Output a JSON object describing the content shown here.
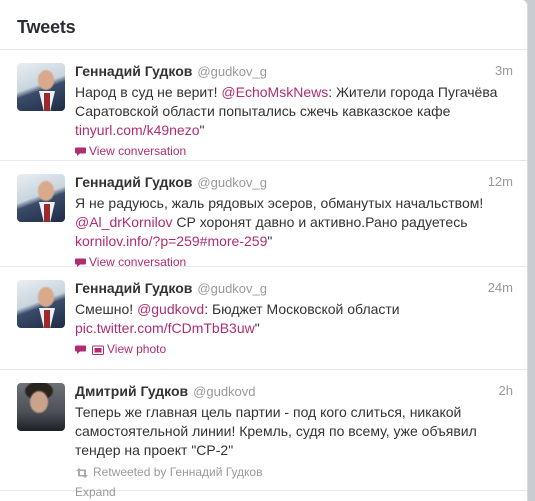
{
  "header": {
    "title": "Tweets"
  },
  "tweets": [
    {
      "name": "Геннадий Гудков",
      "handle": "@gudkov_g",
      "time": "3m",
      "text_before": "Народ в суд не верит! ",
      "mention": "@EchoMskNews",
      "text_after": ": Жители города Пугачёва Саратовской области попытались сжечь кавказское кафе ",
      "url": "tinyurl.com/k49nezo",
      "tail": "\"",
      "action": "View conversation"
    },
    {
      "name": "Геннадий Гудков",
      "handle": "@gudkov_g",
      "time": "12m",
      "text_before": "Я не радуюсь, жаль рядовых эсеров, обманутых начальством! ",
      "mention": "@Al_drKornilov",
      "text_after": " СР хоронят давно и активно.Рано радуетесь ",
      "url": "kornilov.info/?p=259#more-259",
      "tail": "\"",
      "action": "View conversation"
    },
    {
      "name": "Геннадий Гудков",
      "handle": "@gudkov_g",
      "time": "24m",
      "text_before": "Смешно! ",
      "mention": "@gudkovd",
      "text_after": ": Бюджет Московской области ",
      "url": "pic.twitter.com/fCDmTbB3uw",
      "tail": "\"",
      "action": "View photo"
    },
    {
      "name": "Дмитрий Гудков",
      "handle": "@gudkovd",
      "time": "2h",
      "text": "Теперь же главная цель партии - под кого слиться, никакой самостоятельной линии! Кремль, судя по всему, уже объявил тендер на проект \"СР-2\"",
      "retweeted_by": "Retweeted by Геннадий Гудков",
      "action": "Expand"
    }
  ],
  "colors": {
    "link": "#b02d6f",
    "muted": "#999999"
  },
  "icons": {
    "conversation": "speech-bubble-icon",
    "photo": "photo-icon",
    "retweet": "retweet-icon"
  }
}
